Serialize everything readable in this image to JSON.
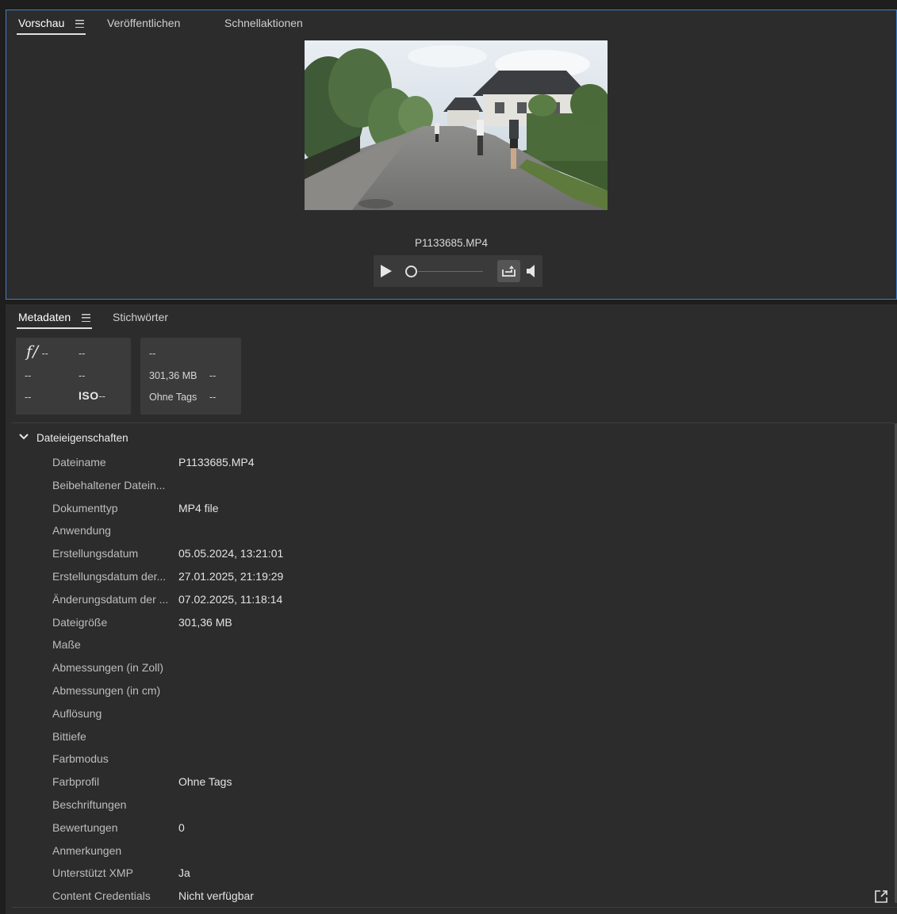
{
  "preview_tabs": [
    {
      "label": "Vorschau",
      "active": true
    },
    {
      "label": "Veröffentlichen",
      "active": false
    },
    {
      "label": "Schnellaktionen",
      "active": false
    }
  ],
  "preview": {
    "filename": "P1133685.MP4",
    "thumbnail_alt": "Video-Vorschau: Läufer auf einer Straße"
  },
  "player": {
    "play_icon": "play-icon",
    "loop_icon": "loop-icon",
    "volume_icon": "volume-icon",
    "progress": 0
  },
  "meta_tabs": [
    {
      "label": "Metadaten",
      "active": true
    },
    {
      "label": "Stichwörter",
      "active": false
    }
  ],
  "quick_info": {
    "box1": {
      "fstop_glyph": "f/",
      "fstop_value": "--",
      "exposure": "--",
      "focal": "--",
      "exp_bias": "--",
      "metering": "--",
      "iso_label": "ISO",
      "iso_value": "--"
    },
    "box2": {
      "dims": "--",
      "size": "301,36 MB",
      "size_extra": "--",
      "color_profile": "Ohne Tags",
      "profile_extra": "--"
    }
  },
  "section": {
    "title": "Dateieigenschaften",
    "rows": [
      {
        "label": "Dateiname",
        "value": "P1133685.MP4"
      },
      {
        "label": "Beibehaltener Datein...",
        "value": ""
      },
      {
        "label": "Dokumenttyp",
        "value": "MP4 file"
      },
      {
        "label": "Anwendung",
        "value": ""
      },
      {
        "label": "Erstellungsdatum",
        "value": "05.05.2024, 13:21:01"
      },
      {
        "label": "Erstellungsdatum der...",
        "value": "27.01.2025, 21:19:29"
      },
      {
        "label": "Änderungsdatum der ...",
        "value": "07.02.2025, 11:18:14"
      },
      {
        "label": "Dateigröße",
        "value": "301,36 MB"
      },
      {
        "label": "Maße",
        "value": ""
      },
      {
        "label": "Abmessungen (in Zoll)",
        "value": ""
      },
      {
        "label": "Abmessungen (in cm)",
        "value": ""
      },
      {
        "label": "Auflösung",
        "value": ""
      },
      {
        "label": "Bittiefe",
        "value": ""
      },
      {
        "label": "Farbmodus",
        "value": ""
      },
      {
        "label": "Farbprofil",
        "value": "Ohne Tags"
      },
      {
        "label": "Beschriftungen",
        "value": ""
      },
      {
        "label": "Bewertungen",
        "value": "0"
      },
      {
        "label": "Anmerkungen",
        "value": ""
      },
      {
        "label": "Unterstützt XMP",
        "value": "Ja"
      },
      {
        "label": "Content Credentials",
        "value": "Nicht verfügbar"
      }
    ]
  },
  "colors": {
    "panel_bg": "#2c2c2c",
    "app_bg": "#1e1e1e",
    "focus_border": "#3b7fcb",
    "quick_box_bg": "#3b3b3b"
  }
}
